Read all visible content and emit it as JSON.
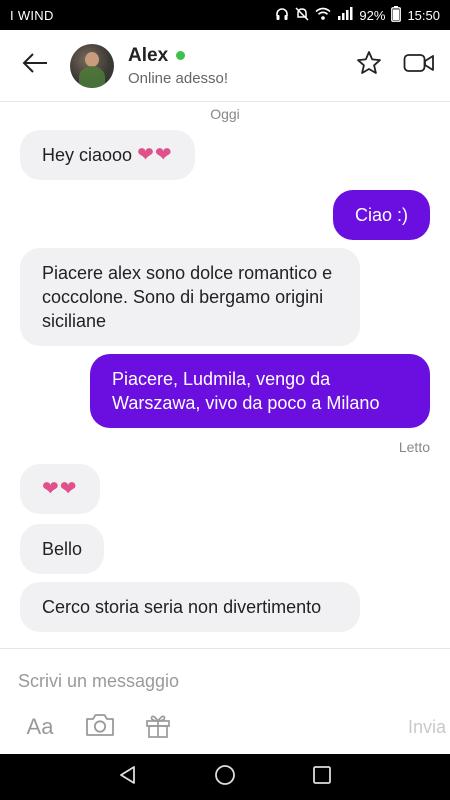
{
  "status_bar": {
    "carrier": "I WIND",
    "battery": "92%",
    "time": "15:50"
  },
  "header": {
    "contact_name": "Alex",
    "contact_status": "Online adesso!"
  },
  "chat": {
    "date_separator": "Oggi",
    "messages": [
      {
        "direction": "in",
        "text": "Hey ciaooo",
        "suffix": "❤❤"
      },
      {
        "direction": "out",
        "text": "Ciao :)"
      },
      {
        "direction": "in",
        "text": "Piacere alex sono dolce romantico e coccolone. Sono di bergamo origini siciliane"
      },
      {
        "direction": "out",
        "text": "Piacere, Ludmila, vengo da Warszawa, vivo da poco a Milano"
      },
      {
        "direction": "in",
        "text": "❤❤"
      },
      {
        "direction": "in",
        "text": "Bello"
      },
      {
        "direction": "in",
        "text": "Cerco storia seria non divertimento"
      }
    ],
    "read_receipt": "Letto"
  },
  "composer": {
    "placeholder": "Scrivi un messaggio",
    "text_style_label": "Aa",
    "send_label": "Invia"
  },
  "icons": {
    "back": "arrow-left-icon",
    "favorite": "star-icon",
    "video_call": "video-camera-icon",
    "camera": "camera-icon",
    "gift": "gift-icon",
    "nav_back": "triangle-back-icon",
    "nav_home": "circle-home-icon",
    "nav_recent": "square-recent-icon"
  },
  "colors": {
    "outgoing_bubble": "#6b0ee0",
    "incoming_bubble": "#f1f1f3",
    "online_dot": "#3cc24a",
    "hearts": "#e0508a"
  }
}
